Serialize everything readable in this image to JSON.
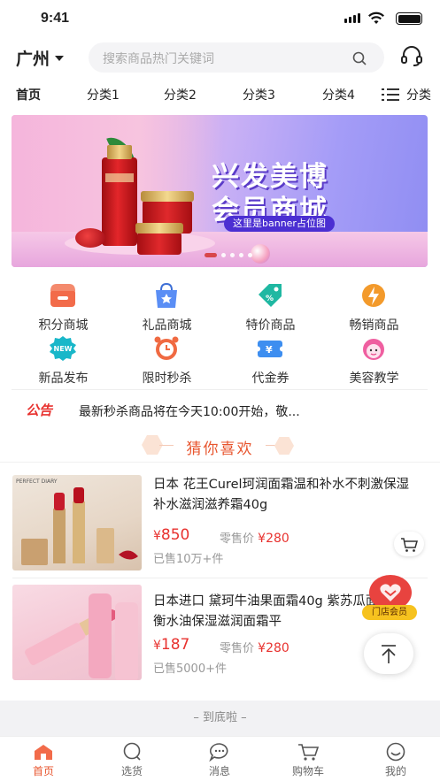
{
  "status_bar": {
    "time": "9:41"
  },
  "header": {
    "city": "广州",
    "search_placeholder": "搜索商品热门关键词",
    "service_icon": "headset-icon"
  },
  "tabs": {
    "items": [
      "首页",
      "分类1",
      "分类2",
      "分类3",
      "分类4"
    ],
    "active_index": 0,
    "category_label": "分类"
  },
  "banner": {
    "title_line1": "兴发美博",
    "title_line2": "会员商城",
    "subtitle": "这里是banner占位图",
    "page_count": 5,
    "active_page": 1
  },
  "shortcuts": [
    {
      "label": "积分商城",
      "icon": "store-icon",
      "color": "#f26b4a"
    },
    {
      "label": "礼品商城",
      "icon": "gift-bag-icon",
      "color": "#5a8ef5"
    },
    {
      "label": "特价商品",
      "icon": "price-tag-icon",
      "color": "#1fb8a2"
    },
    {
      "label": "畅销商品",
      "icon": "flame-icon",
      "color": "#f39a2b"
    },
    {
      "label": "新品发布",
      "icon": "new-badge-icon",
      "color": "#19b7c9"
    },
    {
      "label": "限时秒杀",
      "icon": "alarm-clock-icon",
      "color": "#f06a42"
    },
    {
      "label": "代金券",
      "icon": "coupon-icon",
      "color": "#3d8ef0"
    },
    {
      "label": "美容教学",
      "icon": "beauty-face-icon",
      "color": "#ef5fa0"
    }
  ],
  "notice": {
    "tag": "公告",
    "text": "最新秒杀商品将在今天10:00开始，敬..."
  },
  "recommend": {
    "title": "猜你喜欢"
  },
  "products": [
    {
      "name": "日本 花王Curel珂润面霜温和补水不刺激保湿补水滋润滋养霜40g",
      "price": "850",
      "orig_label": "零售价",
      "orig_price": "280",
      "sold": "已售10万+件",
      "image_brand": "PERFECT DIARY"
    },
    {
      "name": "日本进口 黛珂牛油果面霜40g 紫苏瓜面霜 平衡水油保湿滋润面霜平",
      "price": "187",
      "orig_label": "零售价",
      "orig_price": "280",
      "sold": "已售5000+件",
      "image_brand": ""
    }
  ],
  "currency": "¥",
  "floating": {
    "store_member_label": "门店会员"
  },
  "end_text": "– 到底啦 –",
  "tabbar": {
    "items": [
      {
        "label": "首页",
        "icon": "home-icon"
      },
      {
        "label": "选货",
        "icon": "chat-bubble-icon"
      },
      {
        "label": "消息",
        "icon": "message-icon"
      },
      {
        "label": "购物车",
        "icon": "cart-icon"
      },
      {
        "label": "我的",
        "icon": "profile-icon"
      }
    ],
    "active_index": 0
  },
  "colors": {
    "accent": "#e8562f",
    "price": "#e8322f"
  }
}
